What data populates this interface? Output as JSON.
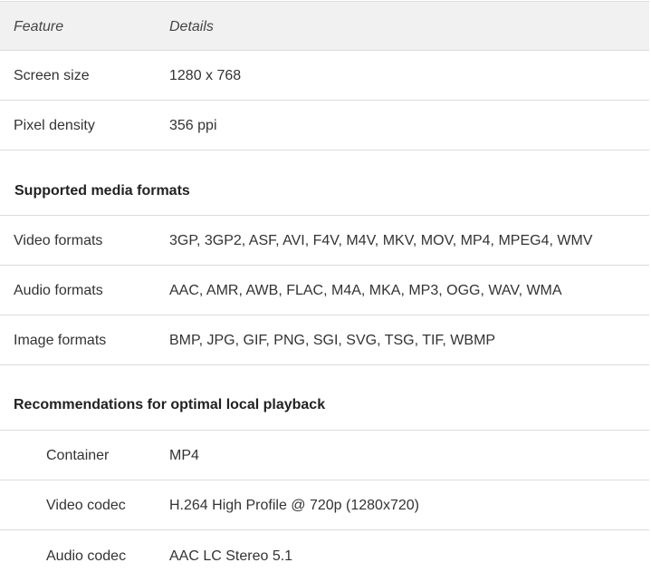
{
  "header": {
    "feature": "Feature",
    "details": "Details"
  },
  "display_rows": [
    {
      "feature": "Screen size",
      "details": "1280 x 768"
    },
    {
      "feature": "Pixel density",
      "details": "356 ppi"
    }
  ],
  "media_section": {
    "title": "Supported media formats",
    "rows": [
      {
        "feature": "Video formats",
        "details": "3GP, 3GP2, ASF, AVI, F4V, M4V, MKV, MOV, MP4, MPEG4, WMV"
      },
      {
        "feature": "Audio formats",
        "details": "AAC, AMR, AWB, FLAC, M4A, MKA, MP3, OGG, WAV, WMA"
      },
      {
        "feature": "Image formats",
        "details": "BMP, JPG, GIF, PNG, SGI, SVG, TSG, TIF, WBMP"
      }
    ]
  },
  "playback_section": {
    "title": "Recommendations for optimal local playback",
    "rows": [
      {
        "feature": "Container",
        "details": "MP4"
      },
      {
        "feature": "Video codec",
        "details": "H.264 High Profile @ 720p (1280x720)"
      },
      {
        "feature": "Audio codec",
        "details": "AAC LC Stereo 5.1"
      }
    ]
  }
}
